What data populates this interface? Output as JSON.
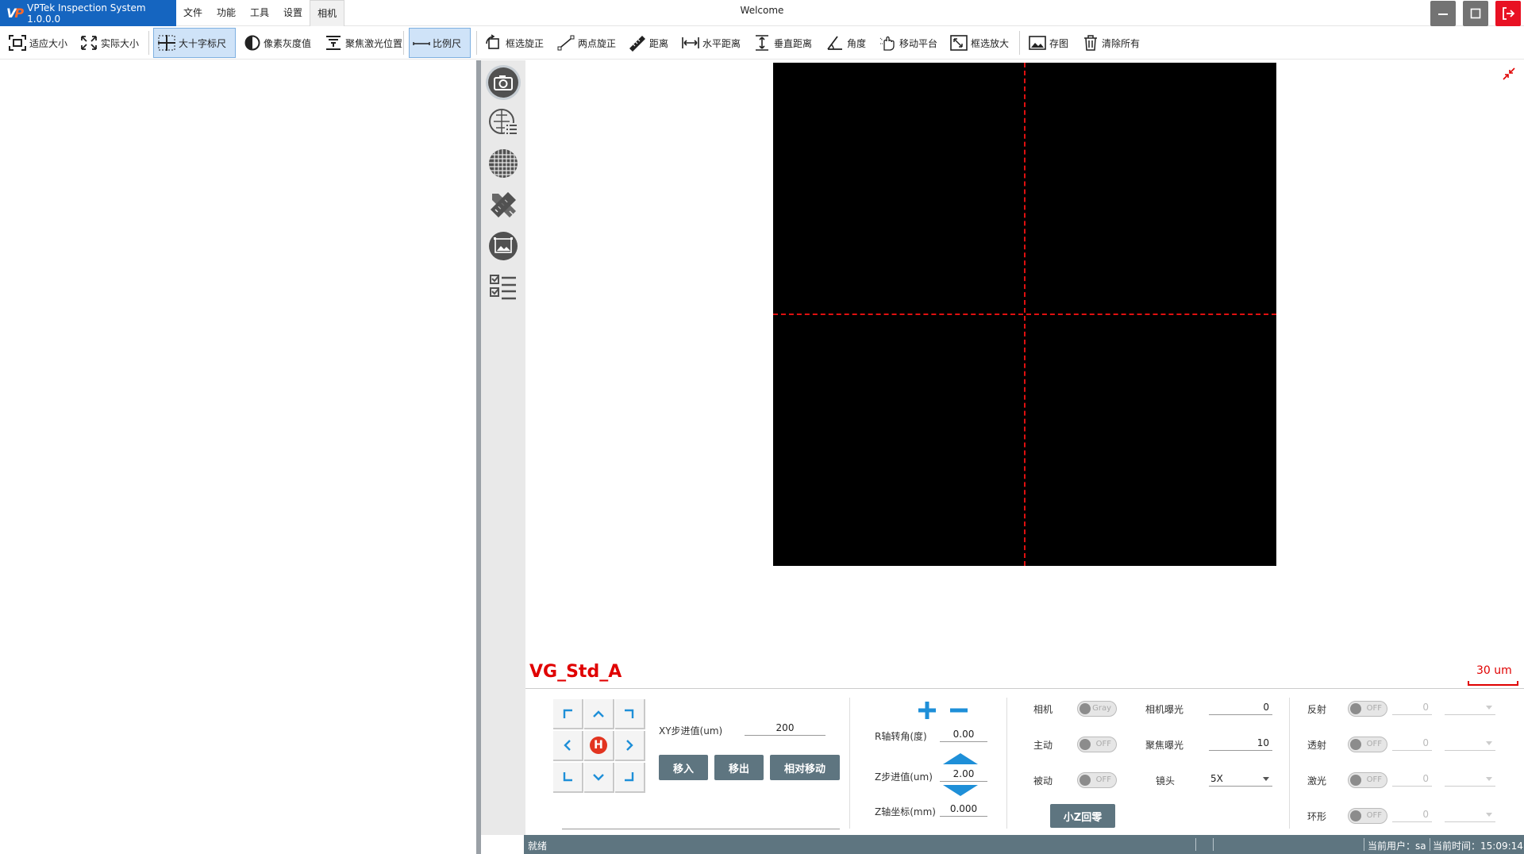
{
  "app": {
    "name": "VPTek Inspection System 1.0.0.0",
    "window_title": "Welcome",
    "menu": [
      "文件",
      "功能",
      "工具",
      "设置",
      "相机"
    ],
    "active_menu_index": 4
  },
  "toolbar": {
    "fit_size": "适应大小",
    "actual_size": "实际大小",
    "crosshair": "大十字标尺",
    "pixel_gray": "像素灰度值",
    "focus_laser": "聚焦激光位置",
    "scale_ruler": "比例尺",
    "box_rotate": "框选旋正",
    "two_point_rotate": "两点旋正",
    "distance": "距离",
    "h_distance": "水平距离",
    "v_distance": "垂直距离",
    "angle": "角度",
    "move_platform": "移动平台",
    "box_zoom": "框选放大",
    "save_image": "存图",
    "clear_all": "清除所有"
  },
  "viewer": {
    "name_label": "VG_Std_A",
    "scale_label": "30 um",
    "crosshair_color": "#e01010"
  },
  "motion": {
    "home_label": "H",
    "xy_step_label": "XY步进值(um)",
    "xy_step_value": "200",
    "move_in": "移入",
    "move_out": "移出",
    "relative_move": "相对移动",
    "r_angle_label": "R轴转角(度)",
    "r_angle_value": "0.00",
    "z_step_label": "Z步进值(um)",
    "z_step_value": "2.00",
    "z_coord_label": "Z轴坐标(mm)",
    "z_coord_value": "0.000"
  },
  "camera": {
    "camera_label": "相机",
    "camera_toggle": "Gray",
    "active_label": "主动",
    "active_toggle": "OFF",
    "passive_label": "被动",
    "passive_toggle": "OFF",
    "exposure_label": "相机曝光",
    "exposure_value": "0",
    "focus_exposure_label": "聚焦曝光",
    "focus_exposure_value": "10",
    "lens_label": "镜头",
    "lens_value": "5X",
    "small_z_home": "小Z回零"
  },
  "lights": [
    {
      "label": "反射",
      "toggle": "OFF",
      "value": "0"
    },
    {
      "label": "透射",
      "toggle": "OFF",
      "value": "0"
    },
    {
      "label": "激光",
      "toggle": "OFF",
      "value": "0"
    },
    {
      "label": "环形",
      "toggle": "OFF",
      "value": "0"
    }
  ],
  "status": {
    "state": "就绪",
    "user": "当前用户：sa",
    "time": "当前时间：15:09:14"
  }
}
